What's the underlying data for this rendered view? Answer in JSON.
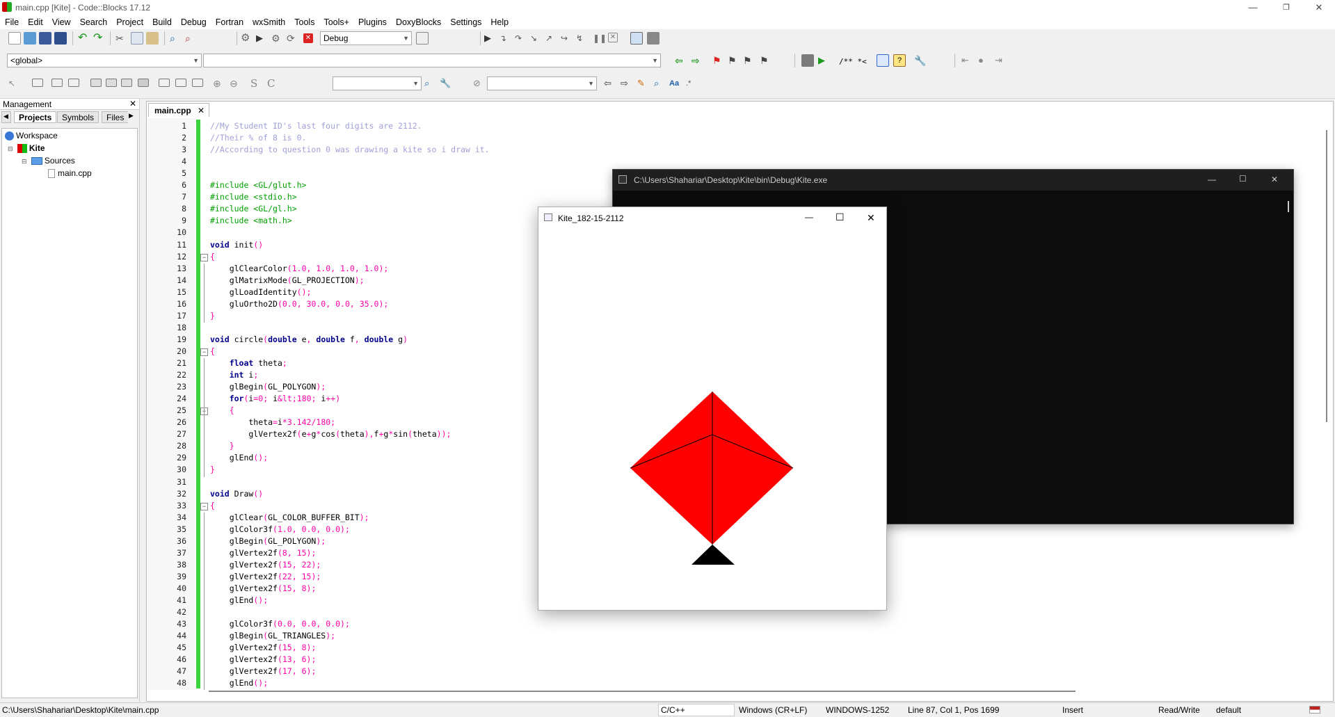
{
  "window": {
    "title": "main.cpp [Kite] - Code::Blocks 17.12",
    "minimize": "—",
    "maximize": "❐",
    "close": "✕"
  },
  "menu": [
    "File",
    "Edit",
    "View",
    "Search",
    "Project",
    "Build",
    "Debug",
    "Fortran",
    "wxSmith",
    "Tools",
    "Tools+",
    "Plugins",
    "DoxyBlocks",
    "Settings",
    "Help"
  ],
  "toolbar": {
    "build_target": "Debug",
    "scope": "<global>",
    "symbol": "",
    "search1": "",
    "search2": "",
    "doxy_text": "/** *<"
  },
  "management": {
    "title": "Management",
    "close": "✕",
    "tabs": [
      "Projects",
      "Symbols",
      "Files"
    ],
    "tree": [
      "Workspace",
      "Kite",
      "Sources",
      "main.cpp"
    ]
  },
  "editor": {
    "tab": "main.cpp",
    "tab_close": "✕",
    "lines": [
      {
        "n": "1",
        "c": "//My Student ID's last four digits are 2112."
      },
      {
        "n": "2",
        "c": "//Their % of 8 is 0."
      },
      {
        "n": "3",
        "c": "//According to question 0 was drawing a kite so i draw it."
      },
      {
        "n": "4",
        "c": ""
      },
      {
        "n": "5",
        "c": ""
      },
      {
        "n": "6",
        "c": "#include <GL/glut.h>"
      },
      {
        "n": "7",
        "c": "#include <stdio.h>"
      },
      {
        "n": "8",
        "c": "#include <GL/gl.h>"
      },
      {
        "n": "9",
        "c": "#include <math.h>"
      },
      {
        "n": "10",
        "c": ""
      },
      {
        "n": "11",
        "c": "void init()"
      },
      {
        "n": "12",
        "c": "{"
      },
      {
        "n": "13",
        "c": "    glClearColor(1.0, 1.0, 1.0, 1.0);"
      },
      {
        "n": "14",
        "c": "    glMatrixMode(GL_PROJECTION);"
      },
      {
        "n": "15",
        "c": "    glLoadIdentity();"
      },
      {
        "n": "16",
        "c": "    gluOrtho2D(0.0, 30.0, 0.0, 35.0);"
      },
      {
        "n": "17",
        "c": "}"
      },
      {
        "n": "18",
        "c": ""
      },
      {
        "n": "19",
        "c": "void circle(double e, double f, double g)"
      },
      {
        "n": "20",
        "c": "{"
      },
      {
        "n": "21",
        "c": "    float theta;"
      },
      {
        "n": "22",
        "c": "    int i;"
      },
      {
        "n": "23",
        "c": "    glBegin(GL_POLYGON);"
      },
      {
        "n": "24",
        "c": "    for(i=0; i<180; i++)"
      },
      {
        "n": "25",
        "c": "    {"
      },
      {
        "n": "26",
        "c": "        theta=i*3.142/180;"
      },
      {
        "n": "27",
        "c": "        glVertex2f(e+g*cos(theta),f+g*sin(theta));"
      },
      {
        "n": "28",
        "c": "    }"
      },
      {
        "n": "29",
        "c": "    glEnd();"
      },
      {
        "n": "30",
        "c": "}"
      },
      {
        "n": "31",
        "c": ""
      },
      {
        "n": "32",
        "c": "void Draw()"
      },
      {
        "n": "33",
        "c": "{"
      },
      {
        "n": "34",
        "c": "    glClear(GL_COLOR_BUFFER_BIT);"
      },
      {
        "n": "35",
        "c": "    glColor3f(1.0, 0.0, 0.0);"
      },
      {
        "n": "36",
        "c": "    glBegin(GL_POLYGON);"
      },
      {
        "n": "37",
        "c": "    glVertex2f(8, 15);"
      },
      {
        "n": "38",
        "c": "    glVertex2f(15, 22);"
      },
      {
        "n": "39",
        "c": "    glVertex2f(22, 15);"
      },
      {
        "n": "40",
        "c": "    glVertex2f(15, 8);"
      },
      {
        "n": "41",
        "c": "    glEnd();"
      },
      {
        "n": "42",
        "c": ""
      },
      {
        "n": "43",
        "c": "    glColor3f(0.0, 0.0, 0.0);"
      },
      {
        "n": "44",
        "c": "    glBegin(GL_TRIANGLES);"
      },
      {
        "n": "45",
        "c": "    glVertex2f(15, 8);"
      },
      {
        "n": "46",
        "c": "    glVertex2f(13, 6);"
      },
      {
        "n": "47",
        "c": "    glVertex2f(17, 6);"
      },
      {
        "n": "48",
        "c": "    glEnd();"
      }
    ]
  },
  "console": {
    "title": "C:\\Users\\Shahariar\\Desktop\\Kite\\bin\\Debug\\Kite.exe",
    "minimize": "—",
    "maximize": "☐",
    "close": "✕"
  },
  "kite_window": {
    "title": "Kite_182-15-2112",
    "minimize": "—",
    "maximize": "☐",
    "close": "✕",
    "kite_color": "#ff0000",
    "tail_color": "#000000"
  },
  "status": {
    "path": "C:\\Users\\Shahariar\\Desktop\\Kite\\main.cpp",
    "lang": "C/C++",
    "eol": "Windows (CR+LF)",
    "encoding": "WINDOWS-1252",
    "position": "Line 87, Col 1, Pos 1699",
    "mode": "Insert",
    "access": "Read/Write",
    "profile": "default"
  }
}
